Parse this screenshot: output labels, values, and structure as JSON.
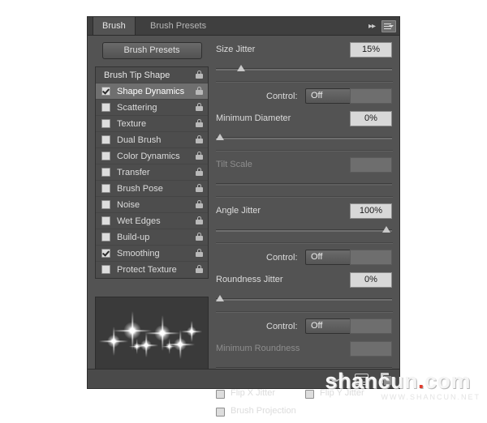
{
  "panel": {
    "tabs": [
      {
        "label": "Brush",
        "active": true
      },
      {
        "label": "Brush Presets",
        "active": false
      }
    ],
    "expand_icon": "double-chevron-right-icon",
    "menu_icon": "panel-menu-icon"
  },
  "left": {
    "presets_button": "Brush Presets",
    "list": [
      {
        "label": "Brush Tip Shape",
        "type": "header",
        "checked": false,
        "selected": false,
        "lock": true
      },
      {
        "label": "Shape Dynamics",
        "type": "item",
        "checked": true,
        "selected": true,
        "lock": true
      },
      {
        "label": "Scattering",
        "type": "item",
        "checked": false,
        "selected": false,
        "lock": true
      },
      {
        "label": "Texture",
        "type": "item",
        "checked": false,
        "selected": false,
        "lock": true
      },
      {
        "label": "Dual Brush",
        "type": "item",
        "checked": false,
        "selected": false,
        "lock": true
      },
      {
        "label": "Color Dynamics",
        "type": "item",
        "checked": false,
        "selected": false,
        "lock": true
      },
      {
        "label": "Transfer",
        "type": "item",
        "checked": false,
        "selected": false,
        "lock": true
      },
      {
        "label": "Brush Pose",
        "type": "item",
        "checked": false,
        "selected": false,
        "lock": true
      },
      {
        "label": "Noise",
        "type": "item",
        "checked": false,
        "selected": false,
        "lock": true
      },
      {
        "label": "Wet Edges",
        "type": "item",
        "checked": false,
        "selected": false,
        "lock": true
      },
      {
        "label": "Build-up",
        "type": "item",
        "checked": false,
        "selected": false,
        "lock": true
      },
      {
        "label": "Smoothing",
        "type": "item",
        "checked": true,
        "selected": false,
        "lock": true
      },
      {
        "label": "Protect Texture",
        "type": "item",
        "checked": false,
        "selected": false,
        "lock": true
      }
    ],
    "preview_name": "brush-stroke-preview"
  },
  "right": {
    "size_jitter": {
      "label": "Size Jitter",
      "value": "15%",
      "slider_pct": 15
    },
    "size_control": {
      "label": "Control:",
      "value": "Off"
    },
    "minimum_diameter": {
      "label": "Minimum Diameter",
      "value": "0%",
      "slider_pct": 0
    },
    "tilt_scale": {
      "label": "Tilt Scale",
      "value": "",
      "slider_pct": 0,
      "disabled": true
    },
    "angle_jitter": {
      "label": "Angle Jitter",
      "value": "100%",
      "slider_pct": 100
    },
    "angle_control": {
      "label": "Control:",
      "value": "Off"
    },
    "roundness_jitter": {
      "label": "Roundness Jitter",
      "value": "0%",
      "slider_pct": 0
    },
    "roundness_control": {
      "label": "Control:",
      "value": "Off"
    },
    "minimum_roundness": {
      "label": "Minimum Roundness",
      "value": "",
      "slider_pct": 0,
      "disabled": true
    },
    "flip_x": {
      "label": "Flip X Jitter",
      "checked": false
    },
    "flip_y": {
      "label": "Flip Y Jitter",
      "checked": false
    },
    "brush_projection": {
      "label": "Brush Projection",
      "checked": false
    }
  },
  "footer": {
    "icons": [
      "brush-stroke-icon",
      "toggle-panel-icon",
      "new-brush-icon"
    ]
  },
  "watermark": {
    "text": "shancun",
    "dot": ".",
    "tld": "com",
    "sub": "WWW.SHANCUN.NET"
  }
}
